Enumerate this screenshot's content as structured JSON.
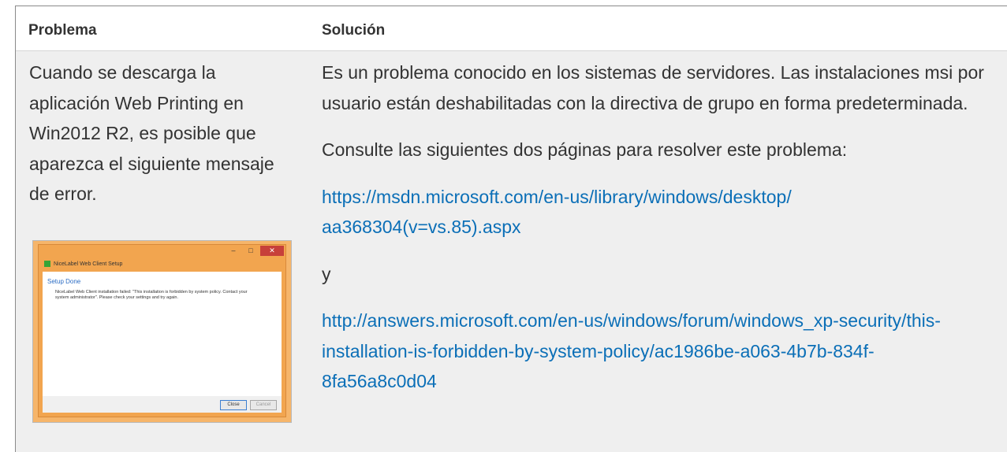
{
  "table": {
    "header": {
      "col1": "Problema",
      "col2": "Solución"
    },
    "row": {
      "problem_text": "Cuando se descarga la aplicación Web Printing en Win2012 R2, es posible que aparezca el siguiente mensaje de error.",
      "solution": {
        "para1": "Es un problema conocido en los sistemas de servidores. Las instalaciones msi por usuario están deshabilitadas con la directiva de grupo en forma predeterminada.",
        "para2": "Consulte las siguientes dos páginas para resolver este problema:",
        "link1": "https://msdn.microsoft.com/en-us/library/windows/desktop/aa368304(v=vs.85).aspx",
        "conjunction": "y",
        "link2": "http://answers.microsoft.com/en-us/windows/forum/windows_xp-security/this-installation-is-forbidden-by-system-policy/ac1986be-a063-4b7b-834f-8fa56a8c0d04"
      }
    }
  },
  "screenshot": {
    "window_title": "NiceLabel Web Client Setup",
    "heading": "Setup Done",
    "message": "NiceLabel Web Client installation failed: \"This installation is forbidden by system policy. Contact your system administrator\". Please check your settings and try again.",
    "close_label": "Close",
    "cancel_label": "Cancel",
    "minimize_glyph": "–",
    "maximize_glyph": "□",
    "close_glyph": "✕"
  },
  "colors": {
    "link": "#0b6fb7",
    "row_bg": "#efefef",
    "window_frame": "#f2a54f"
  }
}
